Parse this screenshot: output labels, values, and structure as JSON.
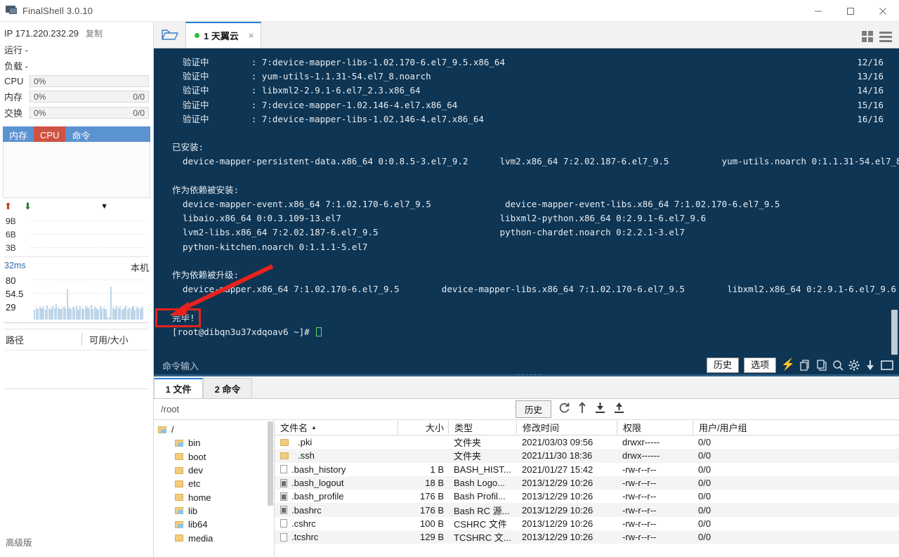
{
  "window": {
    "title": "FinalShell 3.0.10",
    "minimize_label": "Minimize",
    "maximize_label": "Maximize",
    "close_label": "Close"
  },
  "sidebar": {
    "ip_label": "IP 171.220.232.29",
    "copy_label": "复制",
    "runtime": "运行 -",
    "load": "负载 -",
    "meters": [
      {
        "label": "CPU",
        "value": "0%",
        "right": ""
      },
      {
        "label": "内存",
        "value": "0%",
        "right": "0/0"
      },
      {
        "label": "交换",
        "value": "0%",
        "right": "0/0"
      }
    ],
    "proc_tabs": [
      {
        "label": "内存",
        "active": false
      },
      {
        "label": "CPU",
        "active": true
      },
      {
        "label": "命令",
        "active": false
      }
    ],
    "net": {
      "up_icon": "arrow-up-icon",
      "down_icon": "arrow-down-icon",
      "dropdown_icon": "chevron-down-icon",
      "y_labels": [
        "9B",
        "6B",
        "3B"
      ]
    },
    "latency": {
      "value": "32ms",
      "host": "本机",
      "y_labels": [
        "80",
        "54.5",
        "29"
      ]
    },
    "disk": {
      "col_path": "路径",
      "col_free": "可用/大小"
    },
    "edition": "高级版"
  },
  "tabbar": {
    "folder_icon": "folder-open-icon",
    "tabs": [
      {
        "label": "1 天翼云",
        "status": "connected",
        "close": "×"
      }
    ],
    "view_grid_icon": "grid-view-icon",
    "view_list_icon": "list-view-icon"
  },
  "terminal": {
    "lines": [
      {
        "text": "  验证中        : 7:device-mapper-libs-1.02.170-6.el7_9.5.x86_64",
        "right": "12/16"
      },
      {
        "text": "  验证中        : yum-utils-1.1.31-54.el7_8.noarch",
        "right": "13/16"
      },
      {
        "text": "  验证中        : libxml2-2.9.1-6.el7_2.3.x86_64",
        "right": "14/16"
      },
      {
        "text": "  验证中        : 7:device-mapper-1.02.146-4.el7.x86_64",
        "right": "15/16"
      },
      {
        "text": "  验证中        : 7:device-mapper-libs-1.02.146-4.el7.x86_64",
        "right": "16/16"
      },
      {
        "text": "",
        "right": ""
      },
      {
        "text": "已安装:",
        "right": ""
      },
      {
        "text": "  device-mapper-persistent-data.x86_64 0:0.8.5-3.el7_9.2      lvm2.x86_64 7:2.02.187-6.el7_9.5          yum-utils.noarch 0:1.1.31-54.el7_8",
        "right": ""
      },
      {
        "text": "",
        "right": ""
      },
      {
        "text": "作为依赖被安装:",
        "right": ""
      },
      {
        "text": "  device-mapper-event.x86_64 7:1.02.170-6.el7_9.5              device-mapper-event-libs.x86_64 7:1.02.170-6.el7_9.5",
        "right": ""
      },
      {
        "text": "  libaio.x86_64 0:0.3.109-13.el7                              libxml2-python.x86_64 0:2.9.1-6.el7_9.6",
        "right": ""
      },
      {
        "text": "  lvm2-libs.x86_64 7:2.02.187-6.el7_9.5                       python-chardet.noarch 0:2.2.1-3.el7",
        "right": ""
      },
      {
        "text": "  python-kitchen.noarch 0:1.1.1-5.el7",
        "right": ""
      },
      {
        "text": "",
        "right": ""
      },
      {
        "text": "作为依赖被升级:",
        "right": ""
      },
      {
        "text": "  device-mapper.x86_64 7:1.02.170-6.el7_9.5        device-mapper-libs.x86_64 7:1.02.170-6.el7_9.5        libxml2.x86_64 0:2.9.1-6.el7_9.6",
        "right": ""
      },
      {
        "text": "",
        "right": ""
      },
      {
        "text": "完毕!",
        "right": ""
      }
    ],
    "prompt": "[root@dibqn3u37xdqoav6 ~]# ",
    "annotation_color": "#e8221d"
  },
  "command_bar": {
    "placeholder": "命令输入",
    "history_label": "历史",
    "options_label": "选项",
    "icons": [
      "lightning-icon",
      "copy-icon",
      "paste-icon",
      "search-icon",
      "gear-icon",
      "download-icon",
      "window-icon"
    ]
  },
  "file_manager": {
    "tabs": [
      {
        "label": "1 文件",
        "active": true
      },
      {
        "label": "2 命令",
        "active": false
      }
    ],
    "path": "/root",
    "history_label": "历史",
    "toolbar_icons": [
      "refresh-icon",
      "up-arrow-icon",
      "download-icon",
      "upload-icon"
    ],
    "tree": [
      {
        "label": "/",
        "depth": 0,
        "open": true
      },
      {
        "label": "bin",
        "depth": 1,
        "open": true
      },
      {
        "label": "boot",
        "depth": 1,
        "open": false
      },
      {
        "label": "dev",
        "depth": 1,
        "open": false
      },
      {
        "label": "etc",
        "depth": 1,
        "open": false
      },
      {
        "label": "home",
        "depth": 1,
        "open": false
      },
      {
        "label": "lib",
        "depth": 1,
        "open": true
      },
      {
        "label": "lib64",
        "depth": 1,
        "open": true
      },
      {
        "label": "media",
        "depth": 1,
        "open": false
      }
    ],
    "columns": [
      "文件名",
      "大小",
      "类型",
      "修改时间",
      "权限",
      "用户/用户组"
    ],
    "sort_column": "文件名",
    "sort_dir": "asc",
    "rows": [
      {
        "icon": "folder",
        "name": ".pki",
        "size": "",
        "type": "文件夹",
        "mtime": "2021/03/03 09:56",
        "perm": "drwxr-----",
        "owner": "0/0"
      },
      {
        "icon": "folder",
        "name": ".ssh",
        "size": "",
        "type": "文件夹",
        "mtime": "2021/11/30 18:36",
        "perm": "drwx------",
        "owner": "0/0"
      },
      {
        "icon": "file",
        "name": ".bash_history",
        "size": "1 B",
        "type": "BASH_HIST...",
        "mtime": "2021/01/27 15:42",
        "perm": "-rw-r--r--",
        "owner": "0/0"
      },
      {
        "icon": "doc",
        "name": ".bash_logout",
        "size": "18 B",
        "type": "Bash Logo...",
        "mtime": "2013/12/29 10:26",
        "perm": "-rw-r--r--",
        "owner": "0/0"
      },
      {
        "icon": "doc",
        "name": ".bash_profile",
        "size": "176 B",
        "type": "Bash Profil...",
        "mtime": "2013/12/29 10:26",
        "perm": "-rw-r--r--",
        "owner": "0/0"
      },
      {
        "icon": "doc",
        "name": ".bashrc",
        "size": "176 B",
        "type": "Bash RC 源...",
        "mtime": "2013/12/29 10:26",
        "perm": "-rw-r--r--",
        "owner": "0/0"
      },
      {
        "icon": "file",
        "name": ".cshrc",
        "size": "100 B",
        "type": "CSHRC 文件",
        "mtime": "2013/12/29 10:26",
        "perm": "-rw-r--r--",
        "owner": "0/0"
      },
      {
        "icon": "file",
        "name": ".tcshrc",
        "size": "129 B",
        "type": "TCSHRC 文...",
        "mtime": "2013/12/29 10:26",
        "perm": "-rw-r--r--",
        "owner": "0/0"
      }
    ]
  },
  "colors": {
    "terminal_bg": "#0e3554",
    "accent_blue": "#2a7fd4",
    "tab_active_red": "#cf5242",
    "tab_strip_blue": "#5b92d0",
    "annotation_red": "#e8221d",
    "status_green": "#2bbf3a"
  }
}
